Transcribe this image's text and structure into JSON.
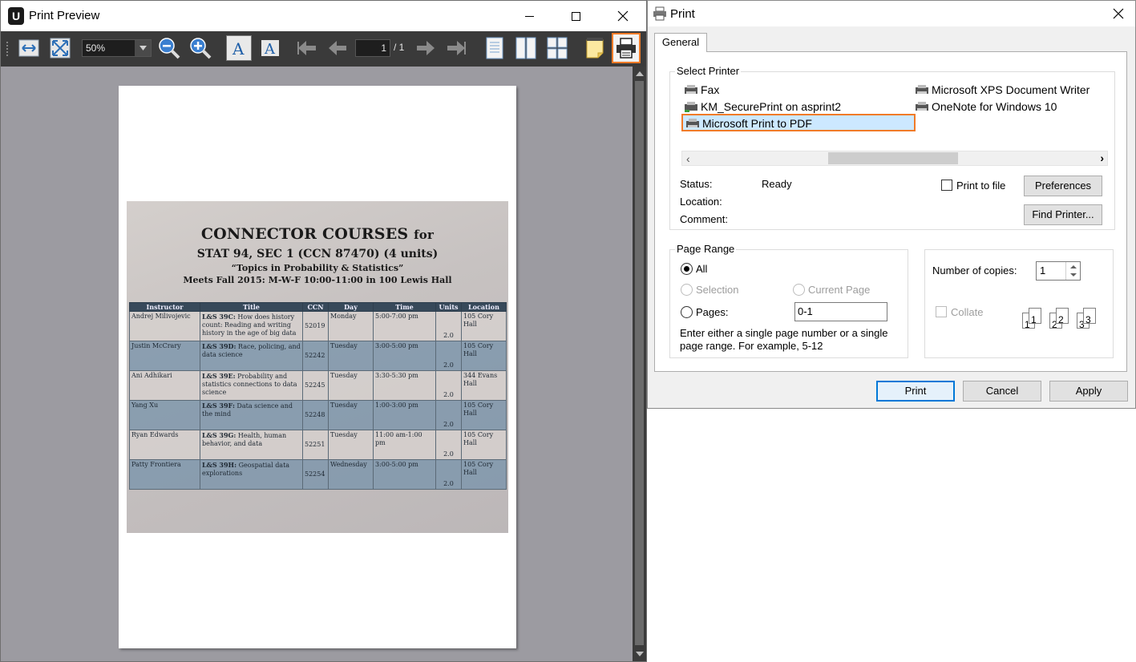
{
  "preview": {
    "title": "Print Preview",
    "app_icon_letter": "U",
    "zoom_value": "50%",
    "page_current": "1",
    "page_total": "/ 1",
    "document": {
      "heading": "CONNECTOR COURSES",
      "heading_suffix": "for",
      "sub1": "STAT 94, SEC 1 (CCN 87470) (4 units)",
      "sub2": "“Topics in Probability & Statistics”",
      "sub3": "Meets Fall 2015: M-W-F 10:00-11:00 in 100 Lewis Hall",
      "columns": [
        "Instructor",
        "Title",
        "CCN",
        "Day",
        "Time",
        "Units",
        "Location"
      ],
      "rows": [
        {
          "instructor": "Andrej Milivojevic",
          "code": "L&S 39C:",
          "title": " How does history count: Reading and writing history in the age of big data",
          "ccn": "52019",
          "day": "Monday",
          "time": "5:00-7:00 pm",
          "units": "2.0",
          "location": "105 Cory Hall"
        },
        {
          "instructor": "Justin McCrary",
          "code": "L&S 39D:",
          "title": " Race, policing, and data science",
          "ccn": "52242",
          "day": "Tuesday",
          "time": "3:00-5:00 pm",
          "units": "2.0",
          "location": "105 Cory Hall"
        },
        {
          "instructor": "Ani Adhikari",
          "code": "L&S 39E:",
          "title": " Probability and statistics connections to data science",
          "ccn": "52245",
          "day": "Tuesday",
          "time": "3:30-5:30 pm",
          "units": "2.0",
          "location": "344 Evans Hall"
        },
        {
          "instructor": "Yang Xu",
          "code": "L&S 39F:",
          "title": " Data science and the mind",
          "ccn": "52248",
          "day": "Tuesday",
          "time": "1:00-3:00 pm",
          "units": "2.0",
          "location": "105 Cory Hall"
        },
        {
          "instructor": "Ryan Edwards",
          "code": "L&S 39G:",
          "title": " Health, human behavior, and data",
          "ccn": "52251",
          "day": "Tuesday",
          "time": "11:00 am-1:00 pm",
          "units": "2.0",
          "location": "105 Cory Hall"
        },
        {
          "instructor": "Patty Frontiera",
          "code": "L&S 39H:",
          "title": " Geospatial data explorations",
          "ccn": "52254",
          "day": "Wednesday",
          "time": "3:00-5:00 pm",
          "units": "2.0",
          "location": "105 Cory Hall"
        }
      ]
    }
  },
  "dialog": {
    "title": "Print",
    "tab": "General",
    "select_printer_label": "Select Printer",
    "printers": [
      "Fax",
      "KM_SecurePrint on asprint2",
      "Microsoft Print to PDF",
      "Microsoft XPS Document Writer",
      "OneNote for Windows 10"
    ],
    "selected_printer": "Microsoft Print to PDF",
    "status_label": "Status:",
    "status_value": "Ready",
    "location_label": "Location:",
    "comment_label": "Comment:",
    "print_to_file": "Print to file",
    "preferences": "Preferences",
    "find_printer": "Find Printer...",
    "page_range_label": "Page Range",
    "opt_all": "All",
    "opt_selection": "Selection",
    "opt_current_page": "Current Page",
    "opt_pages": "Pages:",
    "pages_value": "0-1",
    "range_help": "Enter either a single page number or a single page range.  For example, 5-12",
    "copies_label": "Number of copies:",
    "copies_value": "1",
    "collate": "Collate",
    "collate_pages": [
      "1",
      "1",
      "2",
      "2",
      "3",
      "3"
    ],
    "btn_print": "Print",
    "btn_cancel": "Cancel",
    "btn_apply": "Apply"
  },
  "colors": {
    "highlight_orange": "#f07b28",
    "selection_blue": "#cce8ff",
    "toolbar_dark": "#3a3a3a"
  }
}
